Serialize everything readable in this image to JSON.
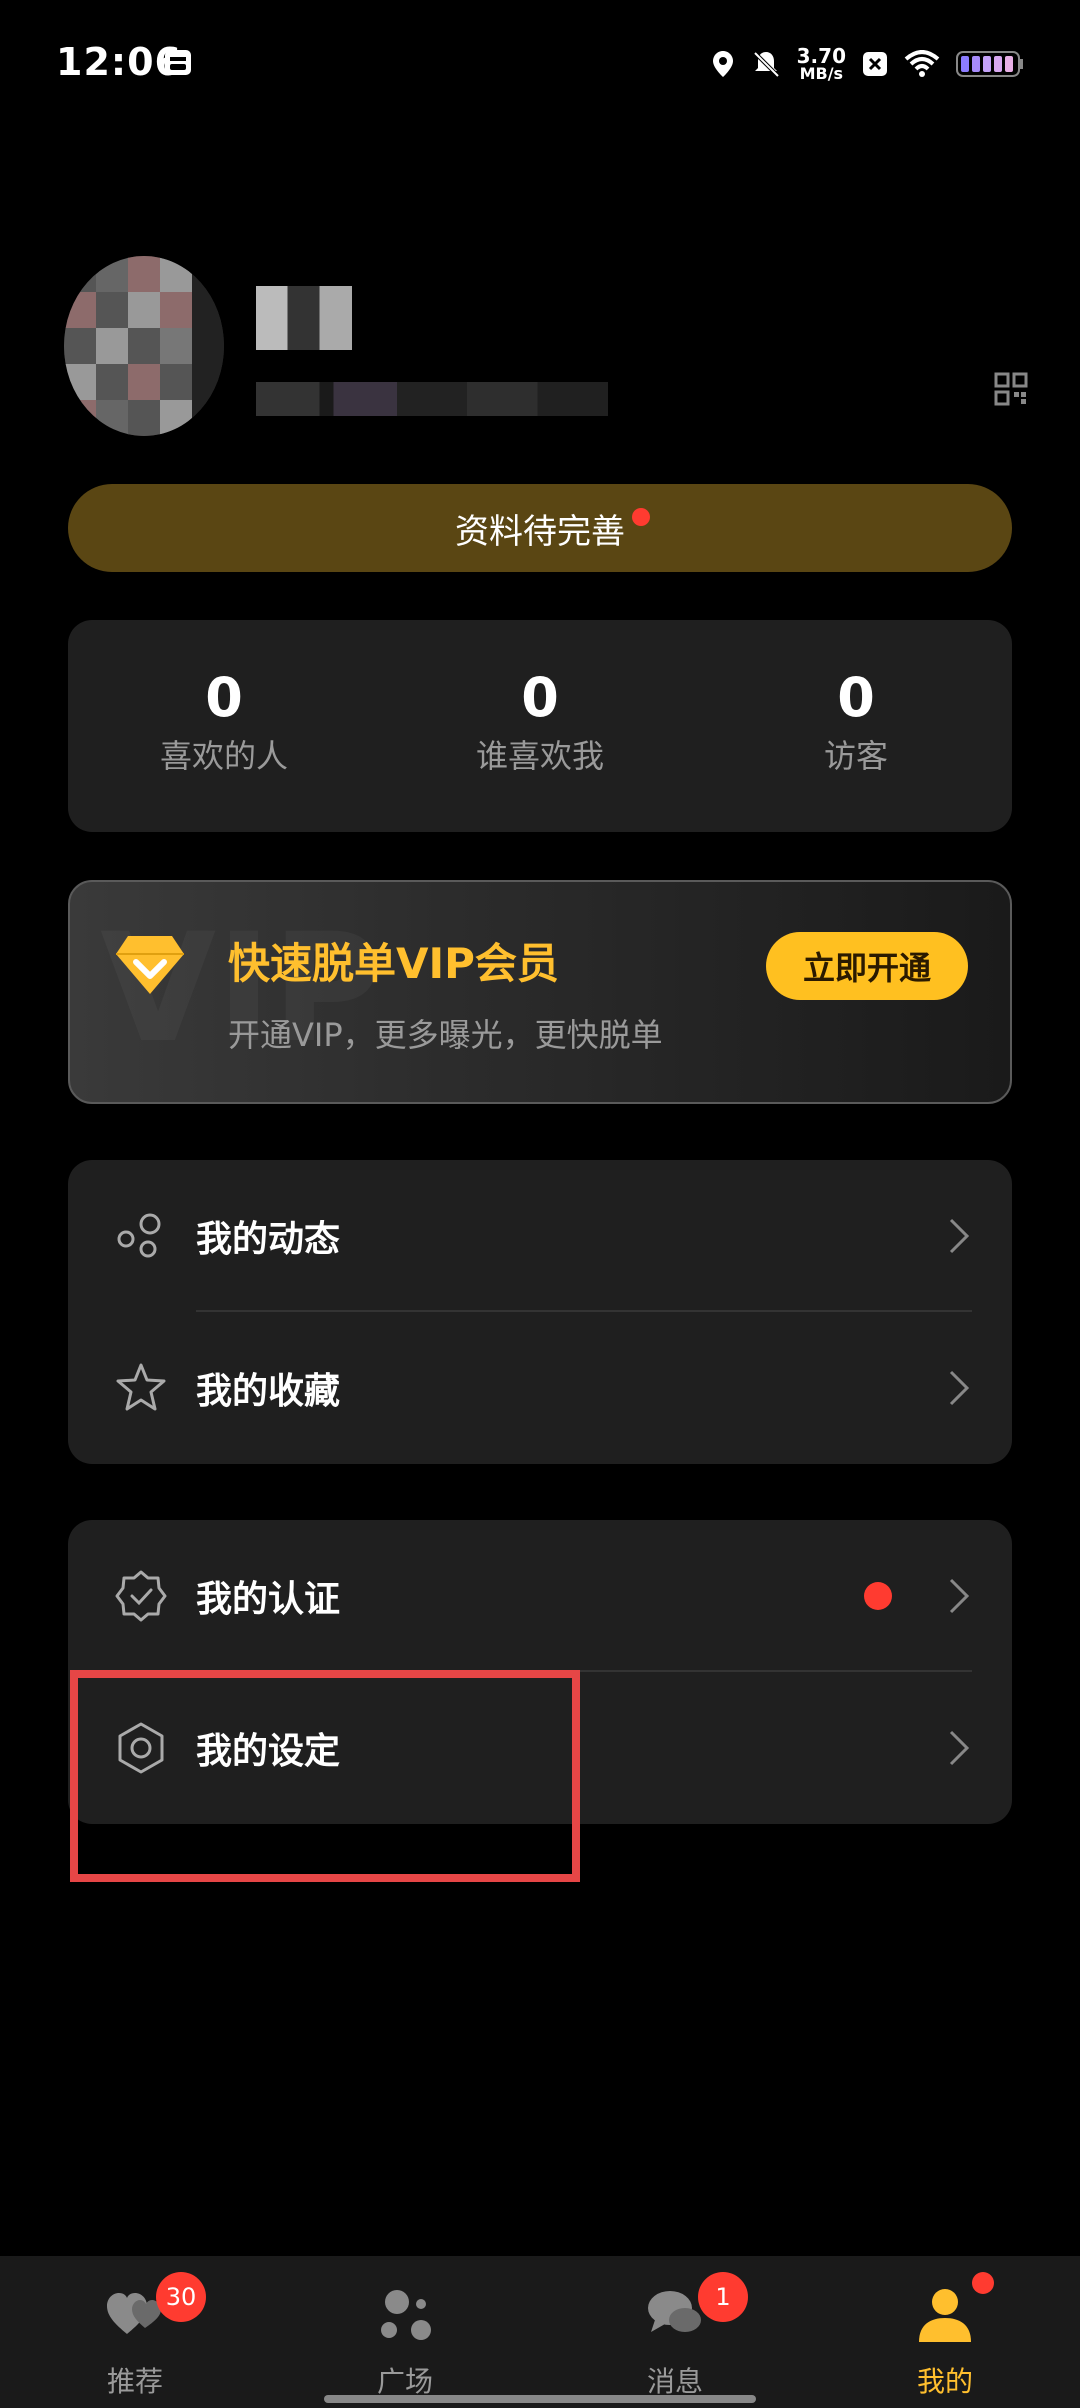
{
  "status_bar": {
    "time": "12:06",
    "net_speed_value": "3.70",
    "net_speed_unit": "MB/s",
    "icons": [
      "location-icon",
      "mute-icon",
      "close-box-icon",
      "wifi-icon",
      "battery-icon"
    ]
  },
  "profile": {
    "complete_profile_label": "资料待完善"
  },
  "stats": [
    {
      "value": "0",
      "label": "喜欢的人"
    },
    {
      "value": "0",
      "label": "谁喜欢我"
    },
    {
      "value": "0",
      "label": "访客"
    }
  ],
  "vip": {
    "title": "快速脱单VIP会员",
    "subtitle": "开通VIP，更多曝光，更快脱单",
    "button": "立即开通",
    "watermark": "VIP"
  },
  "menu_group_1": [
    {
      "label": "我的动态",
      "icon": "moments-icon"
    },
    {
      "label": "我的收藏",
      "icon": "star-icon"
    }
  ],
  "menu_group_2": [
    {
      "label": "我的认证",
      "icon": "verified-badge-icon"
    },
    {
      "label": "我的设定",
      "icon": "settings-hexagon-icon"
    }
  ],
  "bottom_nav": {
    "tabs": [
      {
        "label": "推荐",
        "badge": "30",
        "icon": "hearts-icon"
      },
      {
        "label": "广场",
        "badge": "",
        "icon": "plaza-dots-icon"
      },
      {
        "label": "消息",
        "badge": "1",
        "icon": "chat-bubbles-icon"
      },
      {
        "label": "我的",
        "badge": "",
        "icon": "person-icon"
      }
    ],
    "active_tab": "我的"
  },
  "colors": {
    "accent": "#ffbf2e",
    "badge_red": "#ff3b30",
    "card_bg": "#1f1f1f",
    "highlight_red": "#e64646"
  }
}
